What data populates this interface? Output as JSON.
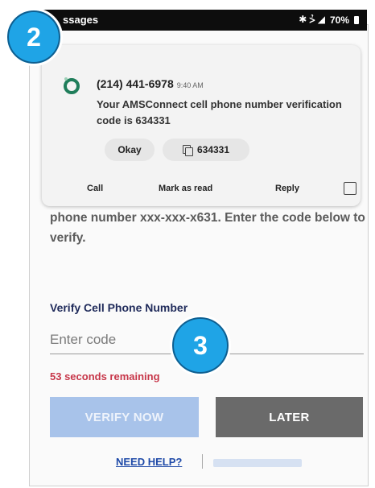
{
  "status_bar": {
    "app_name": "ssages",
    "signal_text": "✱ ⩼ ◢",
    "battery": "70%"
  },
  "notification": {
    "sender": "(214) 441-6978",
    "time": "9:40 AM",
    "body": "Your AMSConnect cell phone number verification code is 634331",
    "okay_label": "Okay",
    "copy_label": "634331",
    "actions": {
      "call": "Call",
      "mark_as_read": "Mark as read",
      "reply": "Reply"
    }
  },
  "verify": {
    "partial_text": "phone number xxx-xxx-x631. Enter the code below to verify.",
    "label": "Verify Cell Phone Number",
    "input_placeholder": "Enter code",
    "countdown": "53 seconds remaining",
    "verify_button": "VERIFY NOW",
    "later_button": "LATER",
    "help_link": "NEED HELP?"
  },
  "badges": {
    "step_a": "2",
    "step_b": "3"
  },
  "colors": {
    "badge": "#1fa4e6",
    "verify_btn": "#a8c3ea",
    "later_btn": "#6a6a6a",
    "countdown": "#c7374a",
    "link": "#1f4aa8"
  }
}
